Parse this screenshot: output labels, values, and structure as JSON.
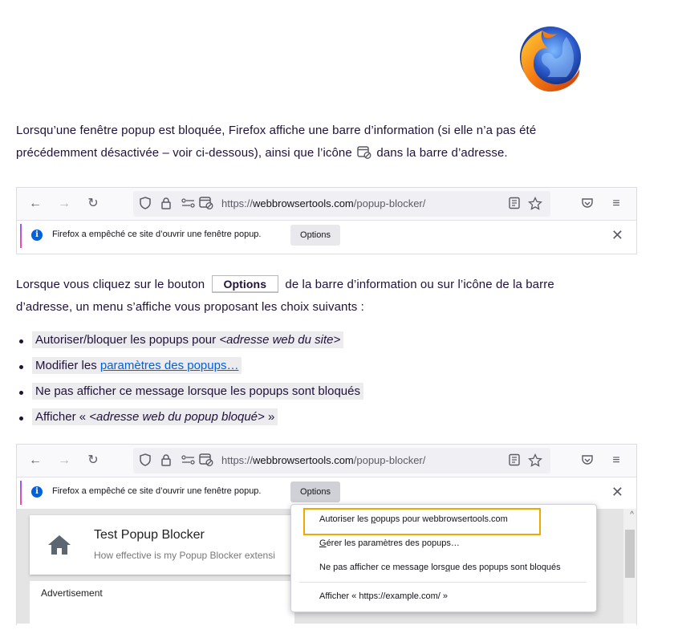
{
  "intro": {
    "line1": "Lorsqu’une fenêtre popup est bloquée, Firefox affiche une barre d’information (si elle n’a pas été",
    "line2_before": "précédemment désactivée – voir ci-dessous), ainsi que l’icône",
    "line2_after": "dans la barre d’adresse."
  },
  "browser": {
    "url_prefix": "https://",
    "url_host": "webbrowsertools.com",
    "url_path": "/popup-blocker/",
    "info_message": "Firefox a empêché ce site d’ouvrir une fenêtre popup.",
    "options_label": "Options"
  },
  "para2": {
    "before_button": "Lorsque vous cliquez sur le bouton",
    "button_label": "Options",
    "after_button": "de la barre d’information ou sur l’icône de la barre",
    "line2": "d’adresse, un menu s’affiche vous proposant les choix suivants :"
  },
  "choices": {
    "item1_text": "Autoriser/bloquer les popups pour ",
    "item1_em": "<adresse web du site>",
    "item2_text": "Modifier les ",
    "item2_link": "paramètres des popups…",
    "item3_text": "Ne pas afficher ce message lorsque les popups sont bloqués",
    "item4_text": "Afficher « ",
    "item4_em": "<adresse web du popup bloqué>",
    "item4_end": " »"
  },
  "page": {
    "card_title": "Test Popup Blocker",
    "card_subtitle": "How effective is my Popup Blocker extensi",
    "ad_label": "Advertisement"
  },
  "menu": {
    "item1_a": "Autoriser les ",
    "item1_u": "p",
    "item1_b": "opups pour webbrowsertools.com",
    "item2_u": "G",
    "item2_b": "érer les paramètres des popups…",
    "item3_a": "Ne pas afficher ce message lors",
    "item3_u": "q",
    "item3_b": "ue des popups sont bloqués",
    "item4": "Afficher « https://example.com/ »"
  },
  "colors": {
    "accent_blue": "#0060df",
    "highlight_border": "#f0a900",
    "text": "#20123a"
  }
}
